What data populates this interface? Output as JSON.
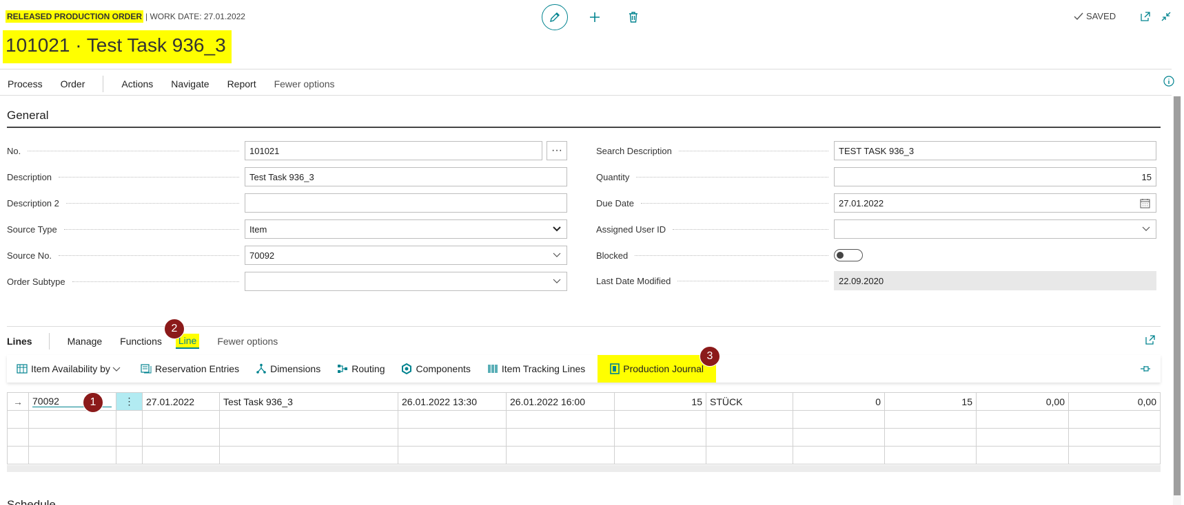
{
  "header": {
    "type_label": "RELEASED PRODUCTION ORDER",
    "work_date": "| WORK DATE: 27.01.2022",
    "title": "101021 · Test Task 936_3",
    "saved": "SAVED"
  },
  "actionbar": {
    "items": [
      "Process",
      "Order",
      "Actions",
      "Navigate",
      "Report",
      "Fewer options"
    ]
  },
  "general": {
    "title": "General",
    "left": [
      {
        "label": "No.",
        "value": "101021"
      },
      {
        "label": "Description",
        "value": "Test Task 936_3"
      },
      {
        "label": "Description 2",
        "value": ""
      },
      {
        "label": "Source Type",
        "value": "Item"
      },
      {
        "label": "Source No.",
        "value": "70092"
      },
      {
        "label": "Order Subtype",
        "value": ""
      }
    ],
    "right": [
      {
        "label": "Search Description",
        "value": "TEST TASK 936_3"
      },
      {
        "label": "Quantity",
        "value": "15"
      },
      {
        "label": "Due Date",
        "value": "27.01.2022"
      },
      {
        "label": "Assigned User ID",
        "value": ""
      },
      {
        "label": "Blocked",
        "value": ""
      },
      {
        "label": "Last Date Modified",
        "value": "22.09.2020"
      }
    ]
  },
  "lines": {
    "title": "Lines",
    "tabs": [
      "Manage",
      "Functions",
      "Line",
      "Fewer options"
    ],
    "subactions": [
      "Item Availability by",
      "Reservation Entries",
      "Dimensions",
      "Routing",
      "Components",
      "Item Tracking Lines",
      "Production Journal"
    ],
    "row": {
      "item_no": "70092",
      "due_date": "27.01.2022",
      "description": "Test Task 936_3",
      "starting": "26.01.2022 13:30",
      "ending": "26.01.2022 16:00",
      "quantity": "15",
      "uom": "STÜCK",
      "finished_qty": "0",
      "remaining_qty": "15",
      "unit_cost": "0,00",
      "cost_amount": "0,00"
    }
  },
  "badges": [
    "1",
    "2",
    "3"
  ],
  "next_section": "Schedule",
  "colors": {
    "accent": "#00838f",
    "highlight": "#ffff00",
    "badge": "#8b1a1a"
  }
}
